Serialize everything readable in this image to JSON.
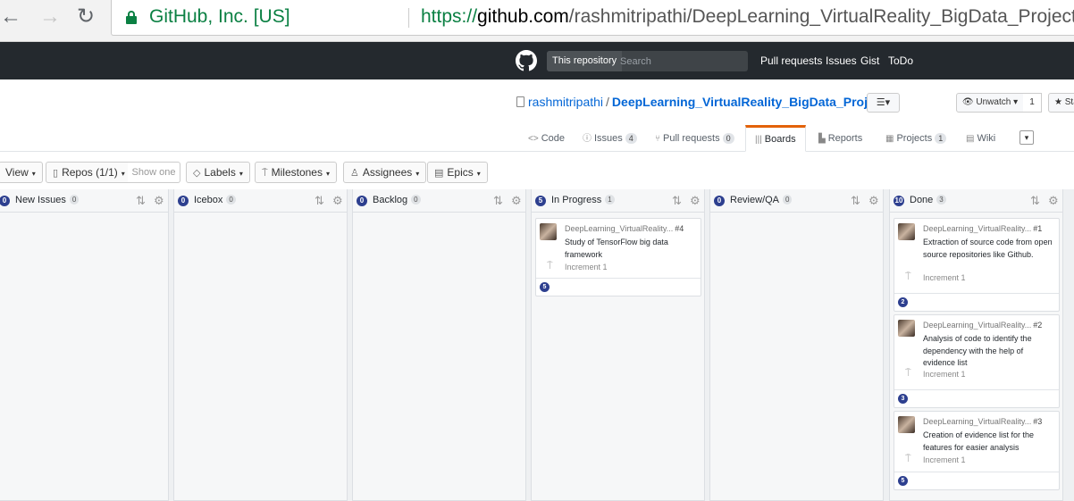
{
  "browser": {
    "back_glyph": "←",
    "forward_glyph": "→",
    "reload_glyph": "↻",
    "ev_cert": "GitHub, Inc. [US]",
    "url_scheme": "https://",
    "url_host": "github.com",
    "url_path": "/rashmitripathi/DeepLearning_VirtualReality_BigData_Project/projects#boa"
  },
  "header": {
    "scope": "This repository",
    "search_placeholder": "Search",
    "links": [
      "Pull requests",
      "Issues",
      "Gist",
      "ToDo"
    ]
  },
  "repo": {
    "owner": "rashmitripathi",
    "separator": "/",
    "name": "DeepLearning_VirtualReality_BigData_Project",
    "list_button": "☰▾",
    "unwatch_label": "👁 Unwatch ▾",
    "watch_count": "1",
    "star_label": "★ Sta"
  },
  "tabs": [
    {
      "icon": "<>",
      "label": "Code",
      "count": ""
    },
    {
      "icon": "ⓘ",
      "label": "Issues",
      "count": "4"
    },
    {
      "icon": "⑂",
      "label": "Pull requests",
      "count": "0"
    },
    {
      "icon": "|||",
      "label": "Boards",
      "count": ""
    },
    {
      "icon": "▙",
      "label": "Reports",
      "count": ""
    },
    {
      "icon": "▦",
      "label": "Projects",
      "count": "1"
    },
    {
      "icon": "▤",
      "label": "Wiki",
      "count": ""
    }
  ],
  "more_glyph": "▾",
  "toolbar": {
    "view": "View",
    "repos": "Repos (1/1)",
    "show_one": "Show one",
    "labels": "Labels",
    "milestones": "Milestones",
    "assignees": "Assignees",
    "epics": "Epics",
    "caret": "▾"
  },
  "columns": [
    {
      "points": "0",
      "title": "New Issues",
      "count": "0",
      "cards": []
    },
    {
      "points": "0",
      "title": "Icebox",
      "count": "0",
      "cards": []
    },
    {
      "points": "0",
      "title": "Backlog",
      "count": "0",
      "cards": []
    },
    {
      "points": "5",
      "title": "In Progress",
      "count": "1",
      "cards": [
        {
          "repo": "DeepLearning_VirtualReality...",
          "num": "#4",
          "title": "Study of TensorFlow big data framework",
          "milestone": "Increment 1",
          "estimate": "5"
        }
      ]
    },
    {
      "points": "0",
      "title": "Review/QA",
      "count": "0",
      "cards": []
    },
    {
      "points": "10",
      "title": "Done",
      "count": "3",
      "cards": [
        {
          "repo": "DeepLearning_VirtualReality...",
          "num": "#1",
          "title": "Extraction of source code from open source repositories like Github.",
          "milestone": "Increment 1",
          "estimate": "2"
        },
        {
          "repo": "DeepLearning_VirtualReality...",
          "num": "#2",
          "title": "Analysis of code to identify the dependency with the help of evidence list",
          "milestone": "Increment 1",
          "estimate": "3"
        },
        {
          "repo": "DeepLearning_VirtualReality...",
          "num": "#3",
          "title": "Creation of evidence list for the features for easier analysis",
          "milestone": "Increment 1",
          "estimate": "5"
        }
      ]
    }
  ],
  "icons": {
    "sort": "⇅",
    "gear": "⚙",
    "milestone": "⍑"
  },
  "colors": {
    "header_bg": "#24292e",
    "link": "#0366d6",
    "estimate_badge": "#2d3f8f",
    "ev_green": "#0b8043",
    "active_tab_accent": "#e36209"
  }
}
